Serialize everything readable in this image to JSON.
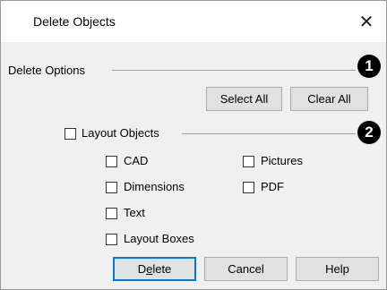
{
  "window": {
    "title": "Delete Objects",
    "close_glyph": "✕"
  },
  "delete_options": {
    "label": "Delete Options",
    "callout": "1",
    "select_all": "Select All",
    "clear_all": "Clear All"
  },
  "layout_objects": {
    "label": "Layout Objects",
    "callout": "2",
    "checked": false,
    "items": [
      {
        "label": "CAD",
        "checked": false
      },
      {
        "label": "Dimensions",
        "checked": false
      },
      {
        "label": "Text",
        "checked": false
      },
      {
        "label": "Layout Boxes",
        "checked": false
      },
      {
        "label": "Pictures",
        "checked": false
      },
      {
        "label": "PDF",
        "checked": false
      }
    ]
  },
  "buttons": {
    "delete_prefix": "D",
    "delete_mnemonic": "e",
    "delete_suffix": "lete",
    "cancel": "Cancel",
    "help": "Help"
  },
  "colors": {
    "focus_border": "#0078d7",
    "dialog_bg": "#f0f0f0"
  }
}
